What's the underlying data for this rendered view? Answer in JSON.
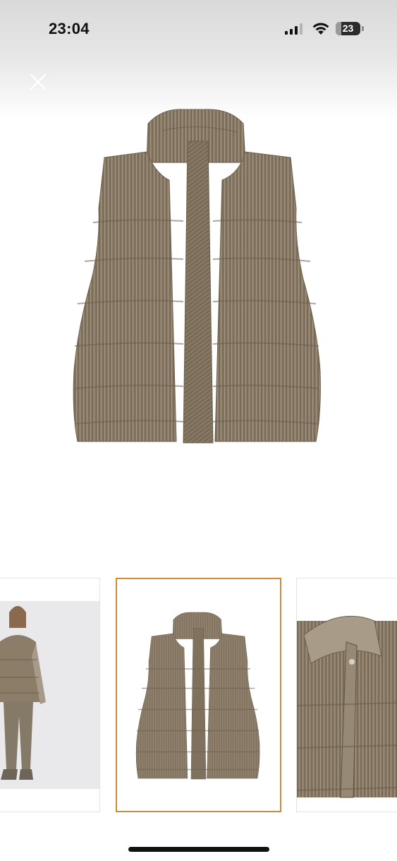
{
  "status_bar": {
    "time": "23:04",
    "battery": "23",
    "battery_level_percent": 23,
    "icons": [
      "cellular-signal-icon",
      "wifi-icon",
      "battery-icon"
    ]
  },
  "header": {
    "close_icon": "close-icon"
  },
  "gallery": {
    "product_color": "#8b7d68",
    "selected_index": 1,
    "selected_border_color": "#d08a3c",
    "thumbnails": [
      {
        "content": "model-wearing-vest"
      },
      {
        "content": "vest-front"
      },
      {
        "content": "vest-collar-detail"
      }
    ]
  }
}
